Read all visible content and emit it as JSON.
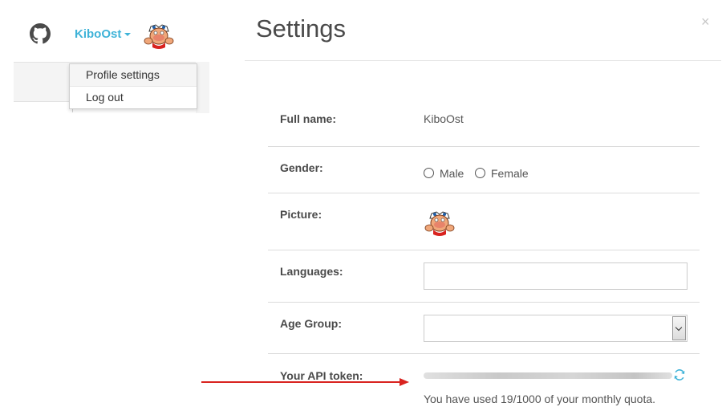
{
  "navbar": {
    "github_icon": "github-icon",
    "username": "KiboOst",
    "avatar_icon": "user-avatar"
  },
  "user_menu": {
    "items": [
      {
        "label": "Profile settings",
        "active": true
      },
      {
        "label": "Log out",
        "active": false
      }
    ]
  },
  "modal": {
    "title": "Settings",
    "close_label": "×",
    "fields": {
      "full_name": {
        "label": "Full name:",
        "value": "KiboOst"
      },
      "gender": {
        "label": "Gender:",
        "options": [
          "Male",
          "Female"
        ]
      },
      "picture": {
        "label": "Picture:"
      },
      "languages": {
        "label": "Languages:",
        "value": ""
      },
      "age_group": {
        "label": "Age Group:",
        "selected": ""
      },
      "api_token": {
        "label": "Your API token:",
        "quota_text": "You have used 19/1000 of your monthly quota."
      }
    }
  },
  "colors": {
    "accent": "#3fb3d8",
    "annotation_arrow": "#d9231f"
  }
}
